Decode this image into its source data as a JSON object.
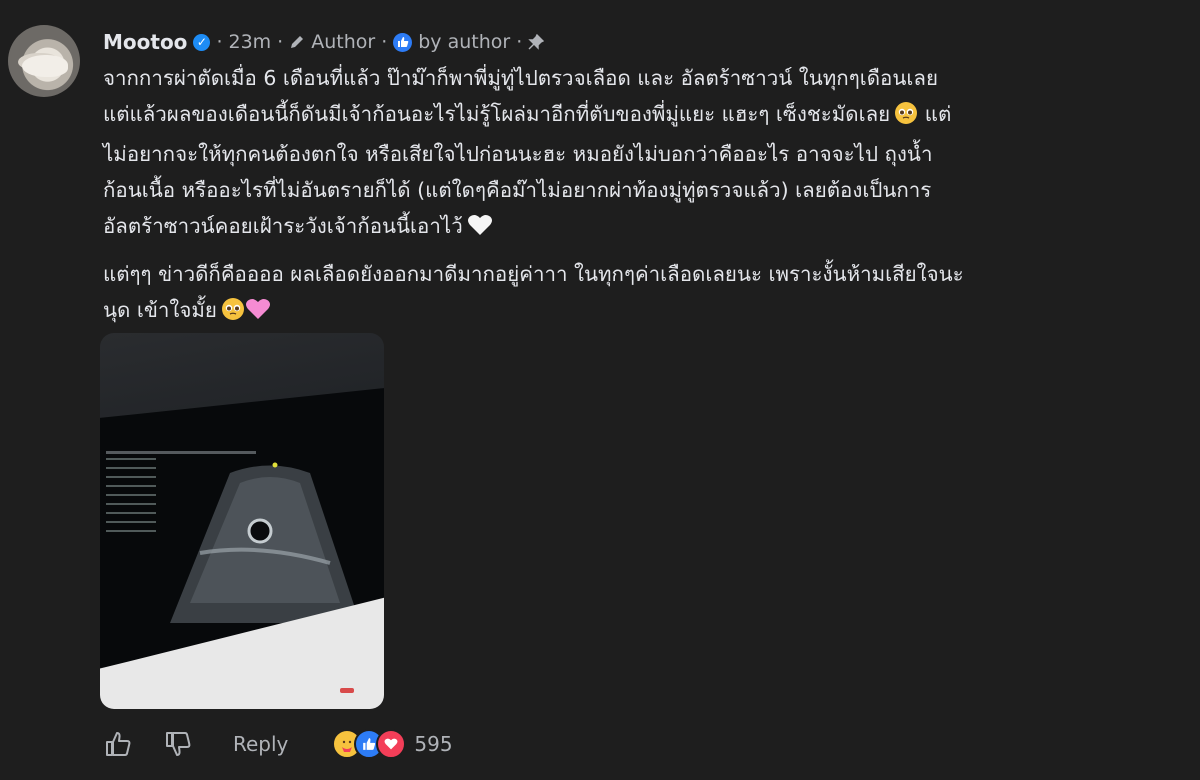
{
  "author": {
    "name": "Mootoo",
    "time": "23m",
    "author_label": "Author",
    "by_author_label": "by author"
  },
  "comment": {
    "paragraph1": [
      "จากการผ่าตัดเมื่อ 6 เดือนที่แล้ว ป๊าม๊าก็พาพี่มู่ทู่ไปตรวจเลือด และ อัลตร้าซาวน์ ในทุกๆเดือนเลย",
      "แต่แล้วผลของเดือนนี้ก็ดันมีเจ้าก้อนอะไรไม่รู้โผล่มาอีกที่ตับของพี่มู่แยะ แฮะๆ เซ็งชะมัดเลย",
      "แต่",
      "ไม่อยากจะให้ทุกคนต้องตกใจ หรือเสียใจไปก่อนนะฮะ หมอยังไม่บอกว่าคืออะไร อาจจะไป ถุงน้ำ",
      "ก้อนเนื้อ หรืออะไรที่ไม่อันตรายก็ได้ (แต่ใดๆคือม๊าไม่อยากผ่าท้องมู่ทู่ตรวจแล้ว) เลยต้องเป็นการ",
      "อัลตร้าซาวน์คอยเฝ้าระวังเจ้าก้อนนี้เอาไว้"
    ],
    "paragraph2": [
      "แต่ๆๆ ข่าวดีก็คืออออ ผลเลือดยังออกมาดีมากอยู่ค่าาา ในทุกๆค่าเลือดเลยนะ เพราะงั้นห้ามเสียใจนะ",
      "นุด เข้าใจมั้ย"
    ],
    "emoji": {
      "pleading": "pleading-face-icon",
      "white_heart": "white-heart-icon",
      "pink_heart": "pink-heart-icon"
    }
  },
  "attachment": {
    "alt": "ultrasound-photo"
  },
  "actions": {
    "reply_label": "Reply",
    "reaction_count": "595",
    "reactions": [
      "care",
      "like",
      "love"
    ]
  },
  "colors": {
    "background": "#1e1e1e",
    "text": "#e4e6eb",
    "muted": "#b0b3b8",
    "verified": "#1d8cf5",
    "like": "#2d7cf6",
    "love": "#f33e58"
  }
}
